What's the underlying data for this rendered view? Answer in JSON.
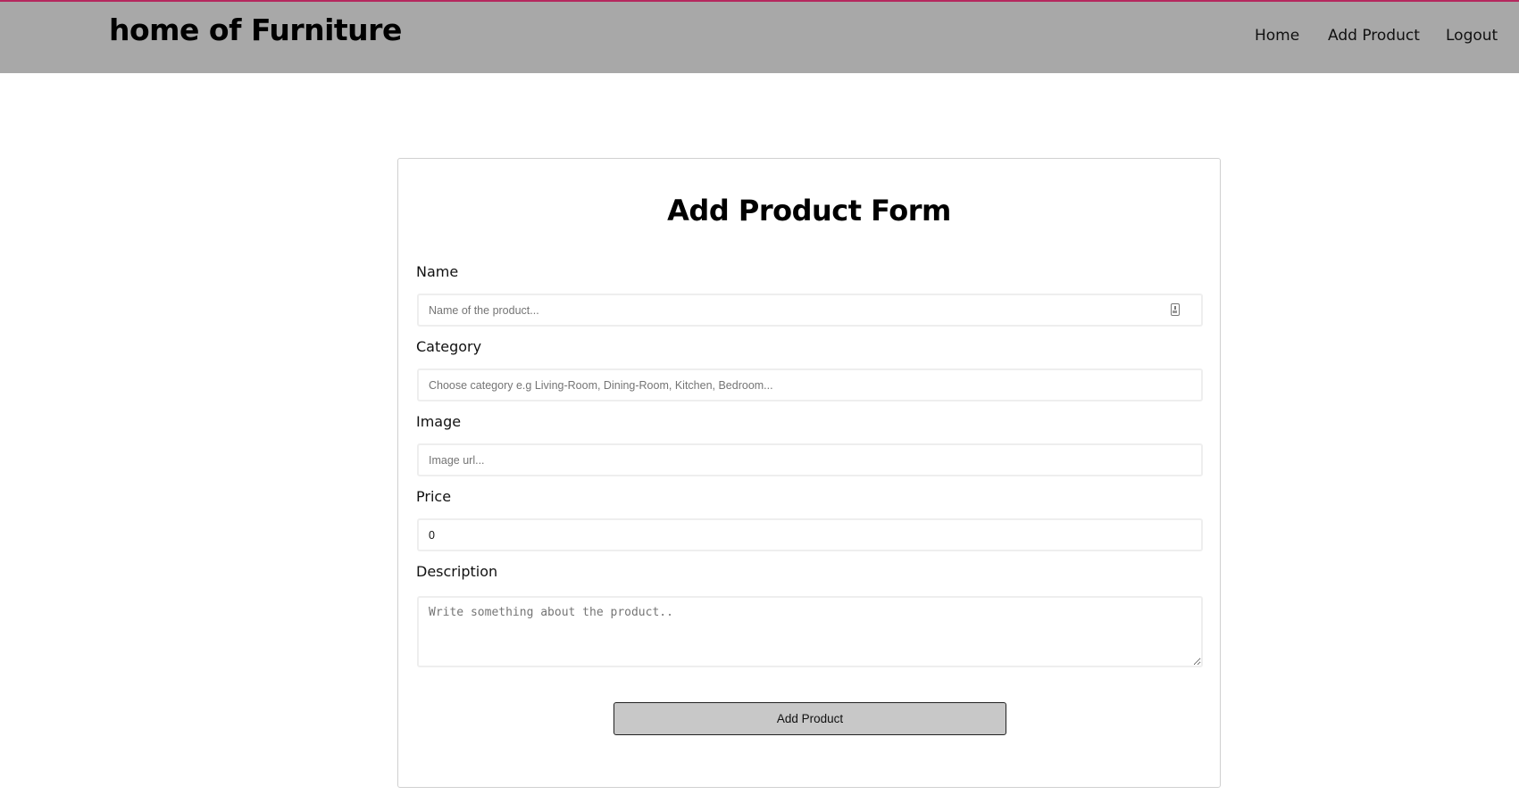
{
  "header": {
    "brand": "home of Furniture",
    "nav": [
      {
        "label": "Home"
      },
      {
        "label": "Add Product"
      },
      {
        "label": "Logout"
      }
    ],
    "accent_color": "#b5285e",
    "background_color": "#a8a8a8"
  },
  "form": {
    "title": "Add Product Form",
    "fields": {
      "name": {
        "label": "Name",
        "placeholder": "Name of the product...",
        "value": ""
      },
      "category": {
        "label": "Category",
        "placeholder": "Choose category e.g Living-Room, Dining-Room, Kitchen, Bedroom...",
        "value": ""
      },
      "image": {
        "label": "Image",
        "placeholder": "Image url...",
        "value": ""
      },
      "price": {
        "label": "Price",
        "placeholder": "",
        "value": "0"
      },
      "description": {
        "label": "Description",
        "placeholder": "Write something about the product..",
        "value": ""
      }
    },
    "submit_label": "Add Product",
    "name_field_icon": "autofill-contact-icon"
  }
}
